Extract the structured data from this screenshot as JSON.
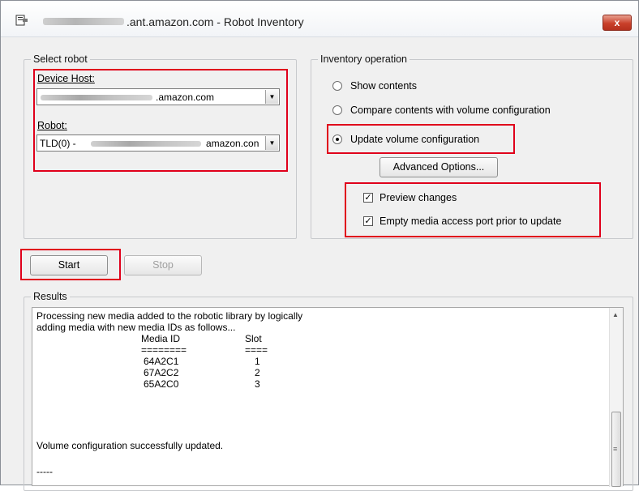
{
  "window": {
    "title": ".ant.amazon.com - Robot Inventory",
    "close_label": "x"
  },
  "select_robot": {
    "legend": "Select robot",
    "device_host_label": "Device Host:",
    "device_host_value": ".amazon.com",
    "robot_label": "Robot:",
    "robot_value_prefix": "TLD(0) -",
    "robot_value_suffix": "amazon.con"
  },
  "inventory_operation": {
    "legend": "Inventory operation",
    "options": [
      {
        "label": "Show contents",
        "checked": false
      },
      {
        "label": "Compare contents with volume configuration",
        "checked": false
      },
      {
        "label": "Update volume configuration",
        "checked": true
      }
    ],
    "advanced_button": "Advanced Options...",
    "checkboxes": [
      {
        "label": "Preview changes",
        "checked": true
      },
      {
        "label": "Empty media access port prior to update",
        "checked": true
      }
    ]
  },
  "actions": {
    "start": "Start",
    "stop": "Stop"
  },
  "results": {
    "legend": "Results",
    "line1": "Processing new media added to the robotic library by logically",
    "line2": "adding media with new media IDs as follows...",
    "col_media_id": "Media ID",
    "col_slot": "Slot",
    "sep_media": "========",
    "sep_slot": "====",
    "rows": [
      {
        "media_id": "64A2C1",
        "slot": "1"
      },
      {
        "media_id": "67A2C2",
        "slot": "2"
      },
      {
        "media_id": "65A2C0",
        "slot": "3"
      }
    ],
    "status": "Volume configuration successfully updated.",
    "trailer": "-----"
  },
  "colors": {
    "highlight": "#e0001b",
    "window_bg": "#f0f0f0"
  },
  "icons": [
    "app-icon",
    "close-icon",
    "dropdown-arrow-icon",
    "scroll-up-icon",
    "scroll-grip-icon"
  ]
}
